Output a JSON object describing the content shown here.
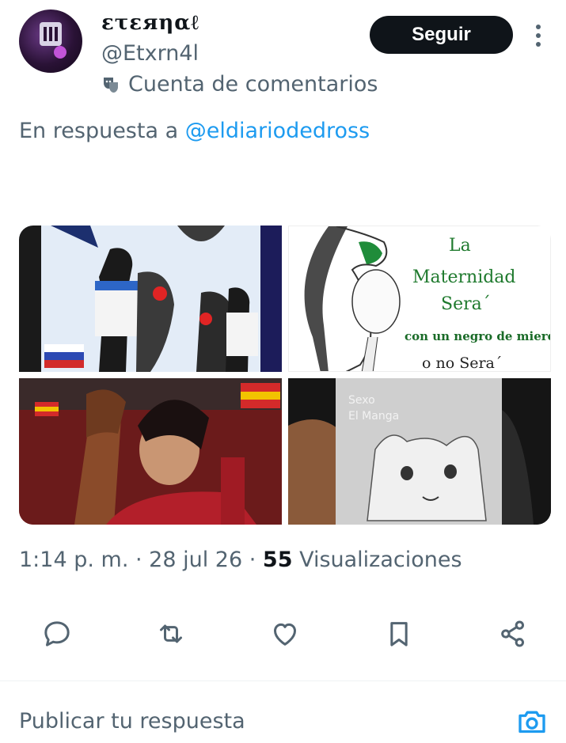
{
  "author": {
    "display_name": "ετεяηαℓ",
    "handle": "@Etxrn4l",
    "account_label": "Cuenta de comentarios",
    "account_label_icon": "theater-masks-icon"
  },
  "follow_button": "Seguir",
  "reply_context": {
    "prefix": "En respuesta a ",
    "mention": "@eldiariodedross"
  },
  "media": {
    "image2_lines": [
      "La",
      "Maternidad",
      "Sera´",
      "con un negro de mierda",
      "o no Sera´"
    ],
    "image4_lines": [
      "Sexo",
      "El Manga"
    ]
  },
  "meta": {
    "time": "1:14 p. m.",
    "separator": " · ",
    "date": "28 jul 26",
    "views_count": "55",
    "views_label": " Visualizaciones"
  },
  "actions": [
    "reply-icon",
    "retweet-icon",
    "like-icon",
    "bookmark-icon",
    "share-icon"
  ],
  "composer": {
    "placeholder": "Publicar tu respuesta"
  },
  "colors": {
    "accent": "#1d9bf0",
    "text": "#0f1419",
    "muted": "#536471"
  }
}
